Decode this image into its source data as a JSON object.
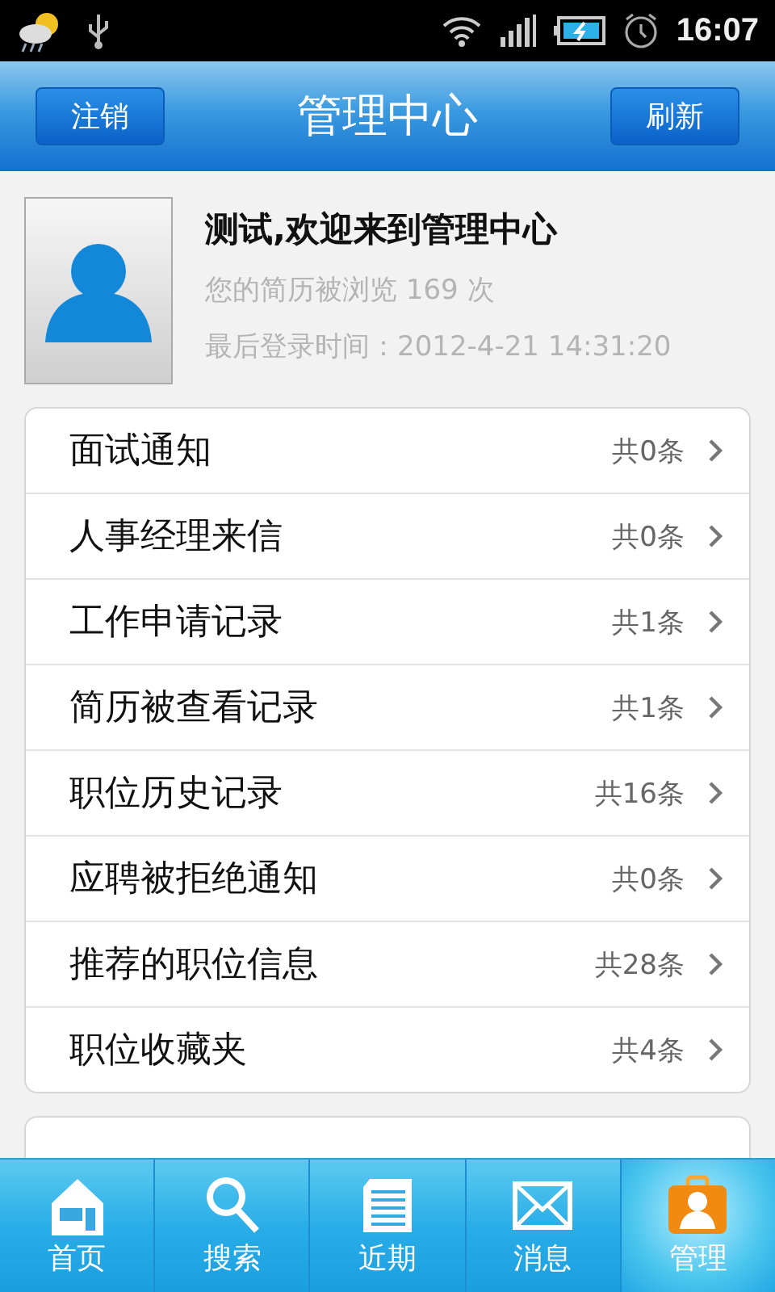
{
  "status_bar": {
    "time": "16:07"
  },
  "header": {
    "title": "管理中心",
    "left_button": "注销",
    "right_button": "刷新"
  },
  "profile": {
    "greeting": "测试,欢迎来到管理中心",
    "views": "您的简历被浏览 169 次",
    "last_login": "最后登录时间：2012-4-21 14:31:20"
  },
  "menu": [
    {
      "label": "面试通知",
      "count": "共0条"
    },
    {
      "label": "人事经理来信",
      "count": "共0条"
    },
    {
      "label": "工作申请记录",
      "count": "共1条"
    },
    {
      "label": "简历被查看记录",
      "count": "共1条"
    },
    {
      "label": "职位历史记录",
      "count": "共16条"
    },
    {
      "label": "应聘被拒绝通知",
      "count": "共0条"
    },
    {
      "label": "推荐的职位信息",
      "count": "共28条"
    },
    {
      "label": "职位收藏夹",
      "count": "共4条"
    }
  ],
  "tabs": [
    {
      "label": "首页",
      "kind": "home",
      "selected": false
    },
    {
      "label": "搜索",
      "kind": "search",
      "selected": false
    },
    {
      "label": "近期",
      "kind": "recent",
      "selected": false
    },
    {
      "label": "消息",
      "kind": "message",
      "selected": false
    },
    {
      "label": "管理",
      "kind": "manage",
      "selected": true
    }
  ]
}
